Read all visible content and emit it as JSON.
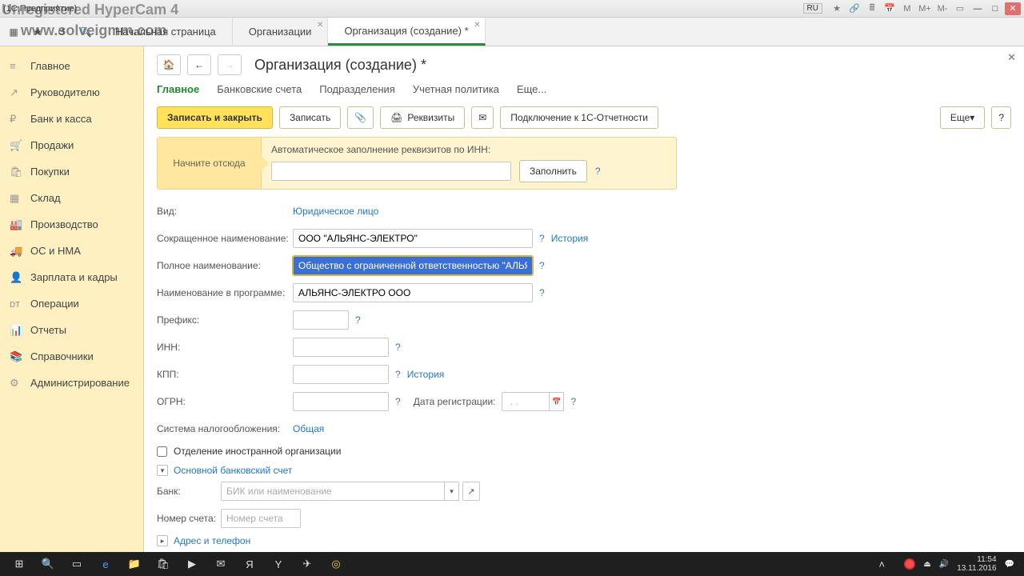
{
  "watermark": {
    "line1": "Unregistered HyperCam 4",
    "line2": "www.solveigmm.com"
  },
  "titlebar": {
    "title": "(1С:Предприятие)",
    "lang": "RU"
  },
  "tabs": {
    "start": "Начальная страница",
    "orgs": "Организации",
    "neworg": "Организация (создание) *"
  },
  "sidebar": {
    "items": [
      {
        "icon": "≡",
        "label": "Главное"
      },
      {
        "icon": "↗",
        "label": "Руководителю"
      },
      {
        "icon": "₽",
        "label": "Банк и касса"
      },
      {
        "icon": "🛒",
        "label": "Продажи"
      },
      {
        "icon": "🛍",
        "label": "Покупки"
      },
      {
        "icon": "▦",
        "label": "Склад"
      },
      {
        "icon": "🏭",
        "label": "Производство"
      },
      {
        "icon": "🚚",
        "label": "ОС и НМА"
      },
      {
        "icon": "👤",
        "label": "Зарплата и кадры"
      },
      {
        "icon": "ᴅᴛ",
        "label": "Операции"
      },
      {
        "icon": "📊",
        "label": "Отчеты"
      },
      {
        "icon": "📚",
        "label": "Справочники"
      },
      {
        "icon": "⚙",
        "label": "Администрирование"
      }
    ]
  },
  "page": {
    "title": "Организация (создание) *"
  },
  "subtabs": {
    "main": "Главное",
    "bank": "Банковские счета",
    "dept": "Подразделения",
    "acct": "Учетная политика",
    "more": "Еще..."
  },
  "actions": {
    "saveclose": "Записать и закрыть",
    "save": "Записать",
    "req": "Реквизиты",
    "connect": "Подключение к 1С-Отчетности",
    "more": "Еще"
  },
  "hint": {
    "start": "Начните отсюда",
    "label": "Автоматическое заполнение реквизитов по ИНН:",
    "fill": "Заполнить"
  },
  "form": {
    "kind_label": "Вид:",
    "kind_value": "Юридическое лицо",
    "short_label": "Сокращенное наименование:",
    "short_value": "ООО \"АЛЬЯНС-ЭЛЕКТРО\"",
    "history": "История",
    "full_label": "Полное наименование:",
    "full_value": "Общество с ограниченной ответственностью \"АЛЬЯНС-ЭЛЕКТРО\"",
    "prog_label": "Наименование в программе:",
    "prog_value": "АЛЬЯНС-ЭЛЕКТРО ООО",
    "prefix_label": "Префикс:",
    "inn_label": "ИНН:",
    "kpp_label": "КПП:",
    "kpp_history": "История",
    "ogrn_label": "ОГРН:",
    "regdate_label": "Дата регистрации:",
    "tax_label": "Система налогообложения:",
    "tax_value": "Общая",
    "foreign_label": "Отделение иностранной организации",
    "bankacc_section": "Основной банковский счет",
    "bank_label": "Банк:",
    "bank_placeholder": "БИК или наименование",
    "accno_label": "Номер счета:",
    "accno_placeholder": "Номер счета",
    "addr_section": "Адрес и телефон"
  },
  "tray": {
    "time": "11:54",
    "date": "13.11.2016"
  }
}
